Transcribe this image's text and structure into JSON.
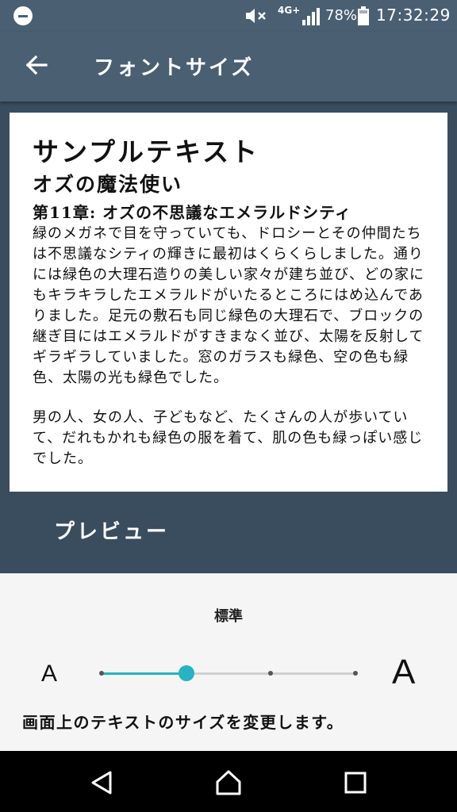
{
  "status_bar": {
    "network": "4G+",
    "battery_percent": "78%",
    "time": "17:32:29",
    "icons": [
      "do-not-disturb-icon",
      "mute-icon",
      "signal-icon",
      "battery-icon"
    ]
  },
  "app_bar": {
    "back_icon": "arrow-left-icon",
    "title": "フォントサイズ"
  },
  "preview": {
    "heading1": "サンプルテキスト",
    "heading2": "オズの魔法使い",
    "heading3": "第11章: オズの不思議なエメラルドシティ",
    "paragraphs": [
      "緑のメガネで目を守っていても、ドロシーとその仲間たちは不思議なシティの輝きに最初はくらくらしました。通りには緑色の大理石造りの美しい家々が建ち並び、どの家にもキラキラしたエメラルドがいたるところにはめ込んでありました。足元の敷石も同じ緑色の大理石で、ブロックの継ぎ目にはエメラルドがすきまなく並び、太陽を反射してギラギラしていました。窓のガラスも緑色、空の色も緑色、太陽の光も緑色でした。",
      "男の人、女の人、子どもなど、たくさんの人が歩いていて、だれもかれも緑色の服を着て、肌の色も緑っぽい感じでした。"
    ],
    "label": "プレビュー"
  },
  "font_size": {
    "level_label": "標準",
    "small_glyph": "A",
    "large_glyph": "A",
    "steps": 4,
    "selected_index": 1,
    "description": "画面上のテキストのサイズを変更します。",
    "accent_color": "#26b3c2"
  },
  "nav_bar": {
    "icons": [
      "back-triangle-icon",
      "home-icon",
      "recents-icon"
    ]
  }
}
